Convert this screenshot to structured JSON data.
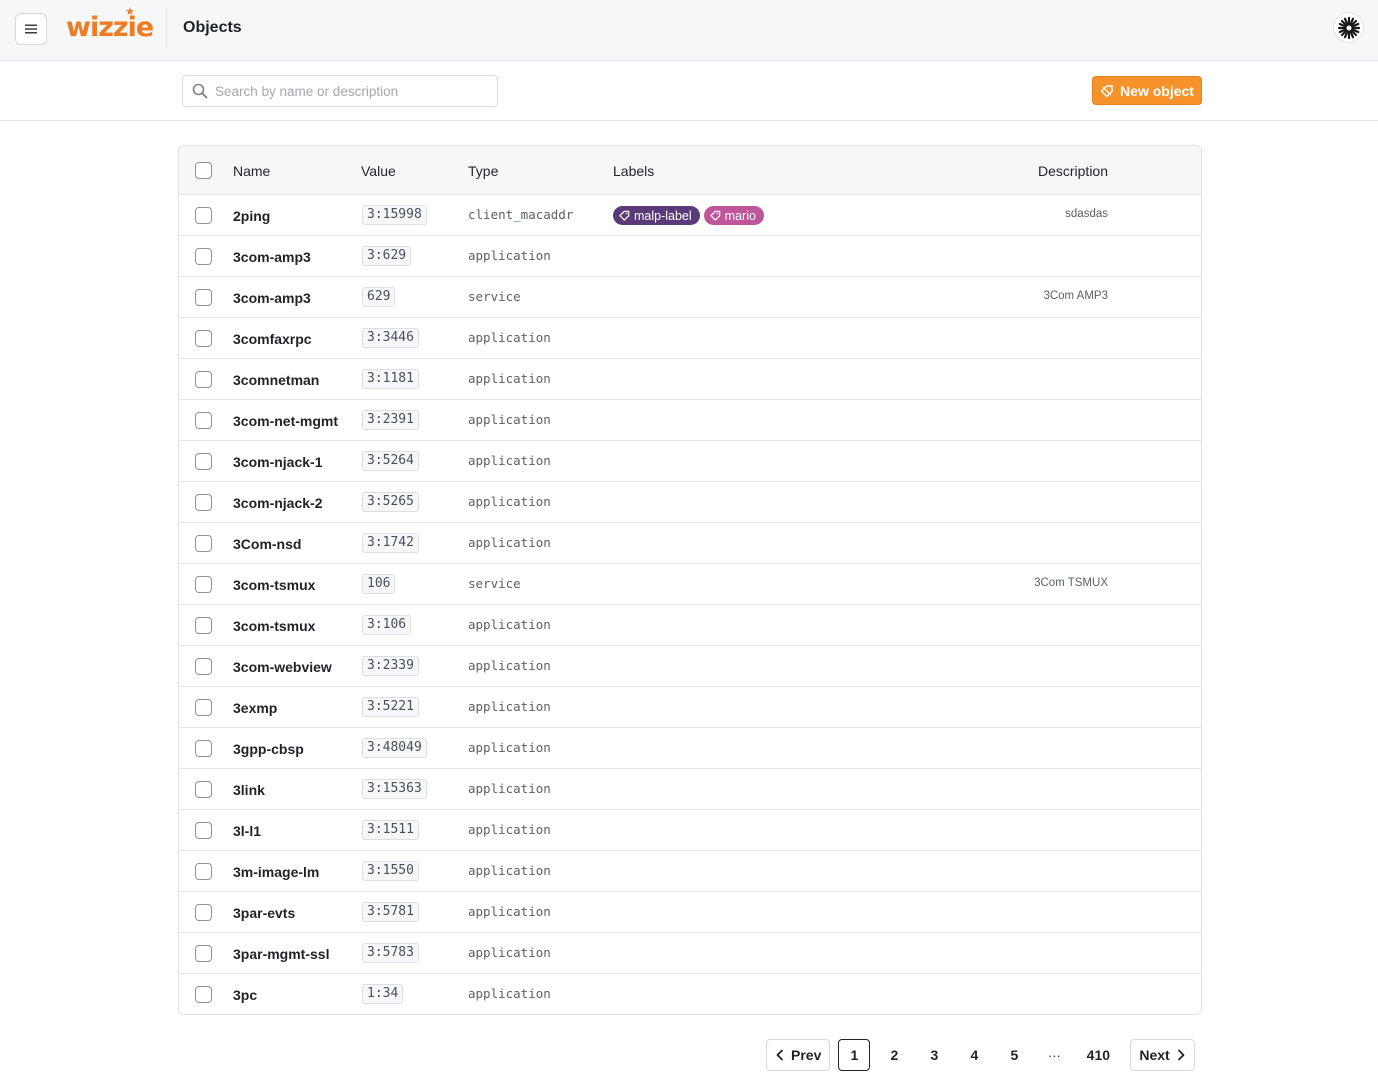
{
  "header": {
    "logo_text": "wizzie",
    "page_title": "Objects"
  },
  "toolbar": {
    "search_placeholder": "Search by name or description",
    "new_button_label": "New object"
  },
  "table": {
    "columns": [
      "Name",
      "Value",
      "Type",
      "Labels",
      "Description"
    ],
    "rows": [
      {
        "name": "2ping",
        "value": "3:15998",
        "type": "client_macaddr",
        "labels": [
          {
            "text": "malp-label",
            "color": "#5b3a7a"
          },
          {
            "text": "mario",
            "color": "#c0569a"
          }
        ],
        "description": "sdasdas"
      },
      {
        "name": "3com-amp3",
        "value": "3:629",
        "type": "application",
        "labels": [],
        "description": ""
      },
      {
        "name": "3com-amp3",
        "value": "629",
        "type": "service",
        "labels": [],
        "description": "3Com AMP3"
      },
      {
        "name": "3comfaxrpc",
        "value": "3:3446",
        "type": "application",
        "labels": [],
        "description": ""
      },
      {
        "name": "3comnetman",
        "value": "3:1181",
        "type": "application",
        "labels": [],
        "description": ""
      },
      {
        "name": "3com-net-mgmt",
        "value": "3:2391",
        "type": "application",
        "labels": [],
        "description": ""
      },
      {
        "name": "3com-njack-1",
        "value": "3:5264",
        "type": "application",
        "labels": [],
        "description": ""
      },
      {
        "name": "3com-njack-2",
        "value": "3:5265",
        "type": "application",
        "labels": [],
        "description": ""
      },
      {
        "name": "3Com-nsd",
        "value": "3:1742",
        "type": "application",
        "labels": [],
        "description": ""
      },
      {
        "name": "3com-tsmux",
        "value": "106",
        "type": "service",
        "labels": [],
        "description": "3Com TSMUX"
      },
      {
        "name": "3com-tsmux",
        "value": "3:106",
        "type": "application",
        "labels": [],
        "description": ""
      },
      {
        "name": "3com-webview",
        "value": "3:2339",
        "type": "application",
        "labels": [],
        "description": ""
      },
      {
        "name": "3exmp",
        "value": "3:5221",
        "type": "application",
        "labels": [],
        "description": ""
      },
      {
        "name": "3gpp-cbsp",
        "value": "3:48049",
        "type": "application",
        "labels": [],
        "description": ""
      },
      {
        "name": "3link",
        "value": "3:15363",
        "type": "application",
        "labels": [],
        "description": ""
      },
      {
        "name": "3l-l1",
        "value": "3:1511",
        "type": "application",
        "labels": [],
        "description": ""
      },
      {
        "name": "3m-image-lm",
        "value": "3:1550",
        "type": "application",
        "labels": [],
        "description": ""
      },
      {
        "name": "3par-evts",
        "value": "3:5781",
        "type": "application",
        "labels": [],
        "description": ""
      },
      {
        "name": "3par-mgmt-ssl",
        "value": "3:5783",
        "type": "application",
        "labels": [],
        "description": ""
      },
      {
        "name": "3pc",
        "value": "1:34",
        "type": "application",
        "labels": [],
        "description": ""
      }
    ]
  },
  "pagination": {
    "prev_label": "Prev",
    "next_label": "Next",
    "pages": [
      "1",
      "2",
      "3",
      "4",
      "5"
    ],
    "ellipsis": "···",
    "last_page": "410",
    "current_page": "1"
  },
  "colors": {
    "accent": "#f7922a",
    "brand": "#ef7c22"
  }
}
